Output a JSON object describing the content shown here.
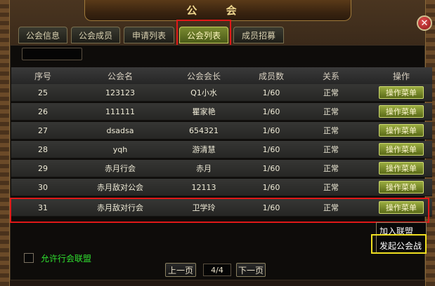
{
  "window": {
    "title": "公 会"
  },
  "tabs": [
    {
      "label": "公会信息"
    },
    {
      "label": "公会成员"
    },
    {
      "label": "申请列表"
    },
    {
      "label": "公会列表"
    },
    {
      "label": "成员招募"
    }
  ],
  "table": {
    "headers": [
      "序号",
      "公会名",
      "公会会长",
      "成员数",
      "关系",
      "操作"
    ],
    "rows": [
      {
        "id": "25",
        "name": "123123",
        "leader": "Q1小水",
        "members": "1/60",
        "relation": "正常",
        "action": "操作菜单"
      },
      {
        "id": "26",
        "name": "111111",
        "leader": "瞿家艳",
        "members": "1/60",
        "relation": "正常",
        "action": "操作菜单"
      },
      {
        "id": "27",
        "name": "dsadsa",
        "leader": "654321",
        "members": "1/60",
        "relation": "正常",
        "action": "操作菜单"
      },
      {
        "id": "28",
        "name": "yqh",
        "leader": "游清慧",
        "members": "1/60",
        "relation": "正常",
        "action": "操作菜单"
      },
      {
        "id": "29",
        "name": "赤月行会",
        "leader": "赤月",
        "members": "1/60",
        "relation": "正常",
        "action": "操作菜单"
      },
      {
        "id": "30",
        "name": "赤月敌对公会",
        "leader": "12113",
        "members": "1/60",
        "relation": "正常",
        "action": "操作菜单"
      },
      {
        "id": "31",
        "name": "赤月敌对行会",
        "leader": "卫学玲",
        "members": "1/60",
        "relation": "正常",
        "action": "操作菜单"
      }
    ]
  },
  "popup_menu": {
    "items": [
      "加入联盟",
      "发起公会战"
    ]
  },
  "footer": {
    "allow_alliance_label": "允许行会联盟",
    "prev_label": "上一页",
    "page_indicator": "4/4",
    "next_label": "下一页"
  },
  "icons": {
    "close": "close-icon"
  }
}
